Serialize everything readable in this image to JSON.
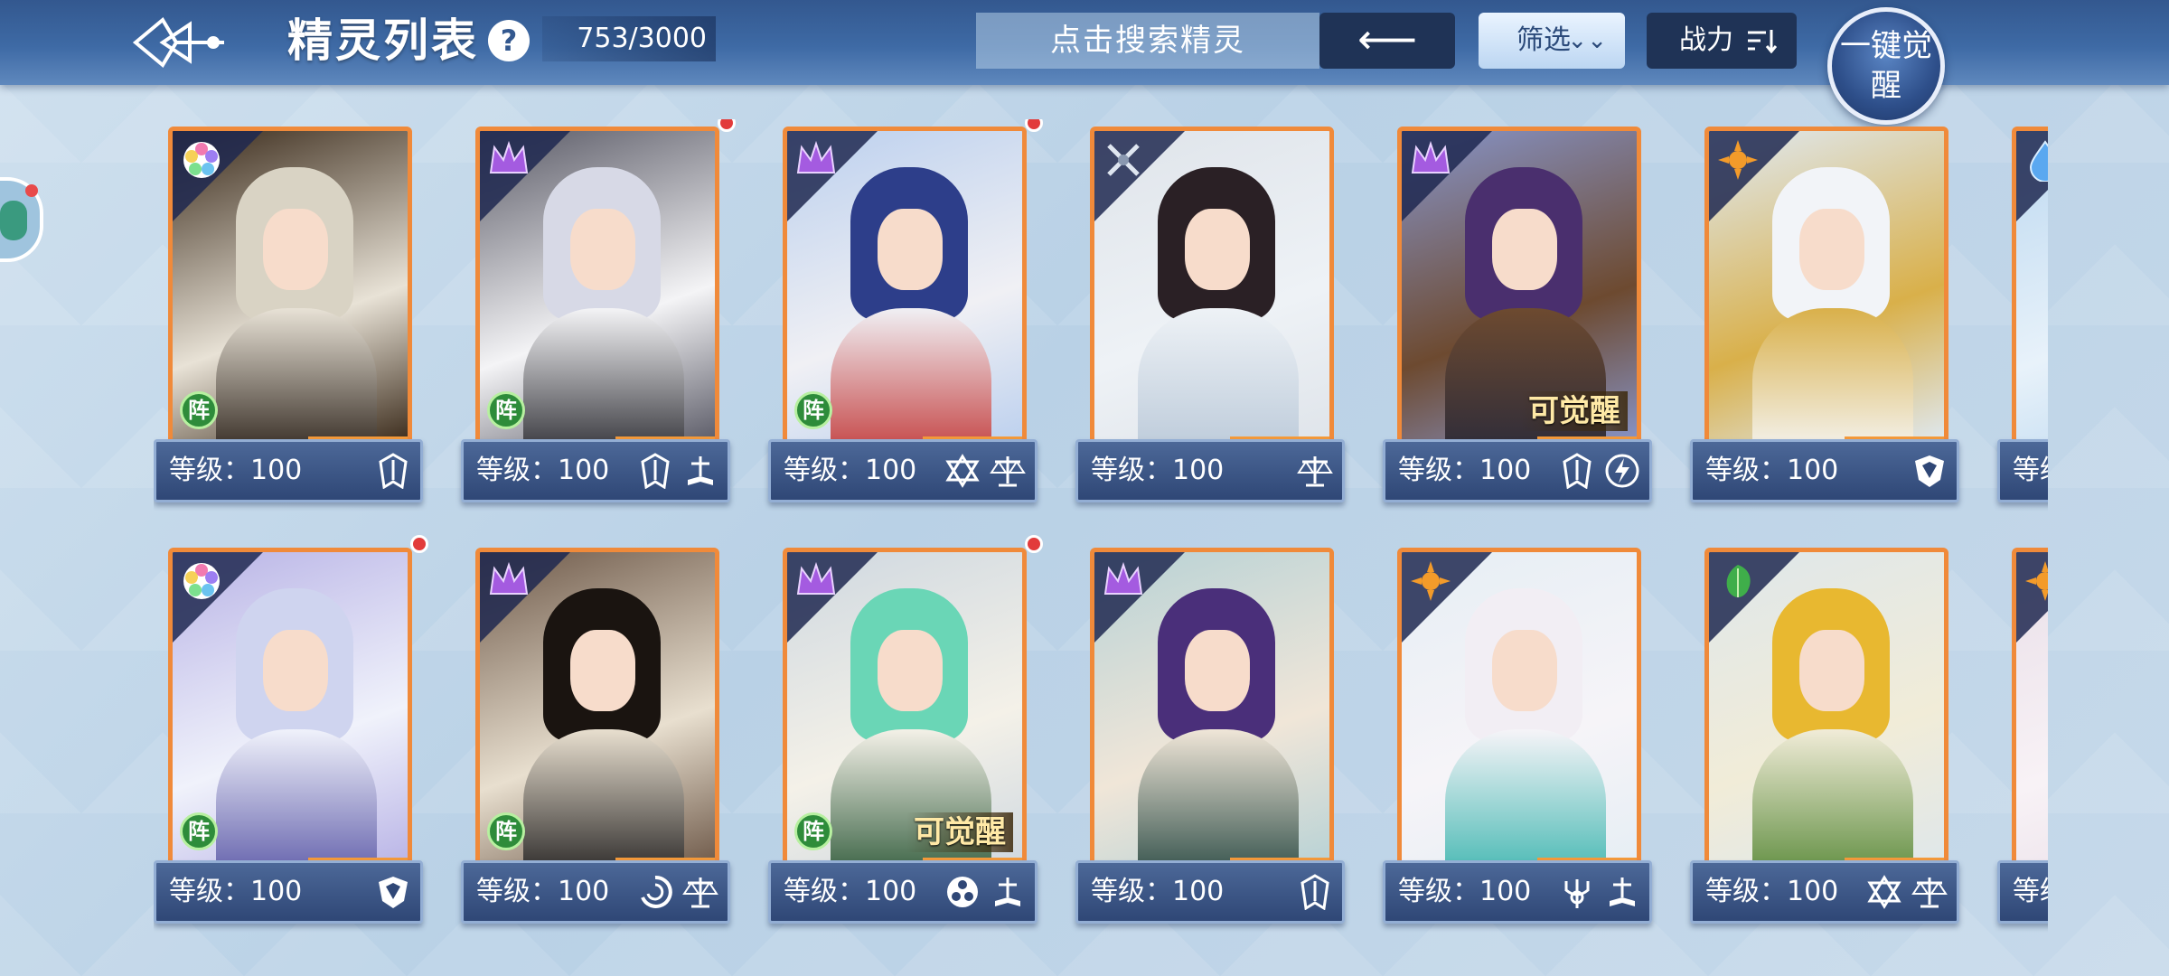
{
  "header": {
    "title": "精灵列表",
    "help": "?",
    "count": "753/3000",
    "search_placeholder": "点击搜索精灵",
    "back_arrow": "⟵",
    "filter_label": "筛选",
    "filter_icon": "chevron-double-down-icon",
    "power_label": "战力",
    "power_icon": "sort-desc-icon",
    "awaken_all_label": "一键觉醒"
  },
  "colors": {
    "topbar": "#3e6aa5",
    "card_border": "#f08a3a",
    "info_bar": "#2f4776",
    "red_dot": "#e23b3b",
    "formation_badge": "#2e8c3a"
  },
  "cards": [
    {
      "level_label": "等级：100",
      "element": "rainbow-flower-icon",
      "formation": "阵",
      "red_dot": false,
      "awaken": "",
      "attrs": [
        "spiky-shield-icon"
      ],
      "art": [
        "#3a2a1a",
        "#d9d3c4",
        "#e8e2d6",
        "#2a2018"
      ]
    },
    {
      "level_label": "等级：100",
      "element": "purple-crown-icon",
      "formation": "阵",
      "red_dot": true,
      "awaken": "",
      "attrs": [
        "spiky-shield-icon",
        "book-scale-icon"
      ],
      "art": [
        "#5a5a66",
        "#d7d9e6",
        "#f4f4f6",
        "#2a2a30"
      ]
    },
    {
      "level_label": "等级：100",
      "element": "purple-crown-icon",
      "formation": "阵",
      "red_dot": true,
      "awaken": "",
      "attrs": [
        "hexagram-icon",
        "scale-icon"
      ],
      "art": [
        "#bcd0ee",
        "#2d3e8a",
        "#f0f0f4",
        "#c23a3a"
      ]
    },
    {
      "level_label": "等级：100",
      "element": "cross-swords-icon",
      "formation": "",
      "red_dot": false,
      "awaken": "",
      "attrs": [
        "scale-icon"
      ],
      "art": [
        "#dfe4ea",
        "#2a2025",
        "#eef2f6",
        "#b9c8d8"
      ]
    },
    {
      "level_label": "等级：100",
      "element": "purple-crown-icon",
      "formation": "",
      "red_dot": false,
      "awaken": "可觉醒",
      "attrs": [
        "spiky-shield-icon",
        "lightning-icon"
      ],
      "art": [
        "#8794c8",
        "#4a2f6e",
        "#6d4a30",
        "#2a2a3a"
      ]
    },
    {
      "level_label": "等级：100",
      "element": "orange-sun-icon",
      "formation": "",
      "red_dot": false,
      "awaken": "",
      "attrs": [
        "shield-icon"
      ],
      "art": [
        "#dfe9f2",
        "#f2f4f8",
        "#d9b04a",
        "#f6f8fb"
      ]
    },
    {
      "level_label": "等级",
      "element": "water-drop-icon",
      "formation": "",
      "red_dot": false,
      "awaken": "",
      "attrs": [],
      "art": [
        "#bcd8f0",
        "#7fb3e0",
        "#e8f2fa",
        "#5f9ad3"
      ],
      "partial": true
    },
    {
      "level_label": "等级：100",
      "element": "rainbow-flower-icon",
      "formation": "阵",
      "red_dot": true,
      "awaken": "",
      "attrs": [
        "shield-icon"
      ],
      "art": [
        "#b9b4e6",
        "#cfd4ef",
        "#f0f2fb",
        "#5d5aa8"
      ]
    },
    {
      "level_label": "等级：100",
      "element": "purple-crown-icon",
      "formation": "阵",
      "red_dot": false,
      "awaken": "",
      "attrs": [
        "vortex-icon",
        "scale-icon"
      ],
      "art": [
        "#6f5a4a",
        "#1a1410",
        "#e8dfcf",
        "#222020"
      ]
    },
    {
      "level_label": "等级：100",
      "element": "purple-crown-icon",
      "formation": "阵",
      "red_dot": true,
      "awaken": "可觉醒",
      "attrs": [
        "trinity-icon",
        "book-scale-icon"
      ],
      "art": [
        "#cfd8e0",
        "#6ad6b6",
        "#f4f1e8",
        "#2f5a3a"
      ]
    },
    {
      "level_label": "等级：100",
      "element": "purple-crown-icon",
      "formation": "",
      "red_dot": false,
      "awaken": "",
      "attrs": [
        "spiky-shield-icon"
      ],
      "art": [
        "#b8d2d6",
        "#4a2f7a",
        "#f0e6d8",
        "#2a4a44"
      ]
    },
    {
      "level_label": "等级：100",
      "element": "orange-sun-icon",
      "formation": "",
      "red_dot": false,
      "awaken": "",
      "attrs": [
        "trident-icon",
        "book-scale-icon"
      ],
      "art": [
        "#e6eef4",
        "#f2eef4",
        "#f6f4f8",
        "#3fb6b0"
      ]
    },
    {
      "level_label": "等级：100",
      "element": "leaf-icon",
      "formation": "",
      "red_dot": false,
      "awaken": "",
      "attrs": [
        "hexagram-icon",
        "scale-icon"
      ],
      "art": [
        "#dfe7ea",
        "#e8b830",
        "#f1ecd8",
        "#5a8a3a"
      ]
    },
    {
      "level_label": "等级",
      "element": "orange-sun-icon",
      "formation": "",
      "red_dot": false,
      "awaken": "",
      "attrs": [],
      "art": [
        "#e9dfe8",
        "#f2c6da",
        "#f8f2f6",
        "#e0b2c8"
      ],
      "partial": true
    }
  ]
}
